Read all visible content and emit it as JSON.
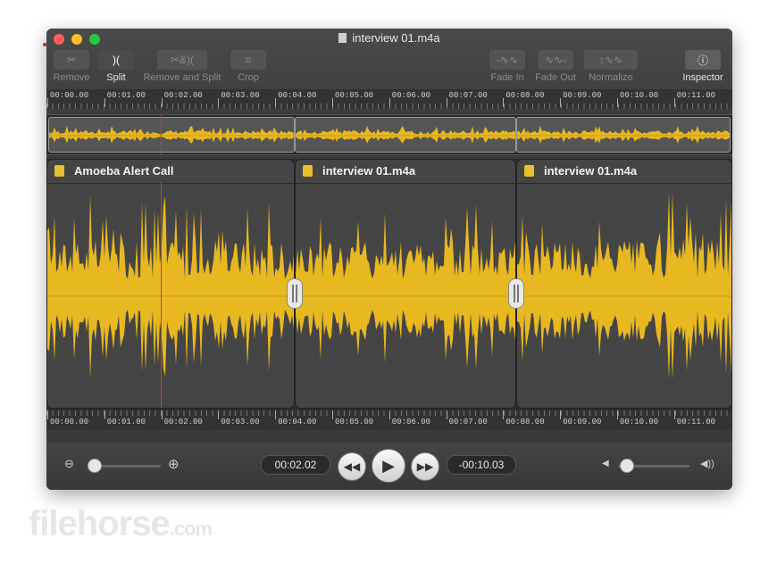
{
  "window": {
    "title": "interview 01.m4a"
  },
  "toolbar": {
    "remove": "Remove",
    "split": "Split",
    "remove_and_split": "Remove and Split",
    "crop": "Crop",
    "fade_in": "Fade In",
    "fade_out": "Fade Out",
    "normalize": "Normalize",
    "inspector": "Inspector"
  },
  "ruler": {
    "ticks": [
      "00:00.00",
      "00:01.00",
      "00:02.00",
      "00:03.00",
      "00:04.00",
      "00:05.00",
      "00:06.00",
      "00:07.00",
      "00:08.00",
      "00:09.00",
      "00:10.00",
      "00:11.00"
    ]
  },
  "clips": [
    {
      "name": "Amoeba Alert Call"
    },
    {
      "name": "interview 01.m4a"
    },
    {
      "name": "interview 01.m4a"
    }
  ],
  "transport": {
    "current_time": "00:02.02",
    "remaining_time": "-00:10.03"
  },
  "watermark": {
    "text": "filehorse",
    "suffix": ".com"
  },
  "colors": {
    "waveform": "#e8b820",
    "playhead": "#e0331f",
    "background": "#3a3a3a"
  }
}
